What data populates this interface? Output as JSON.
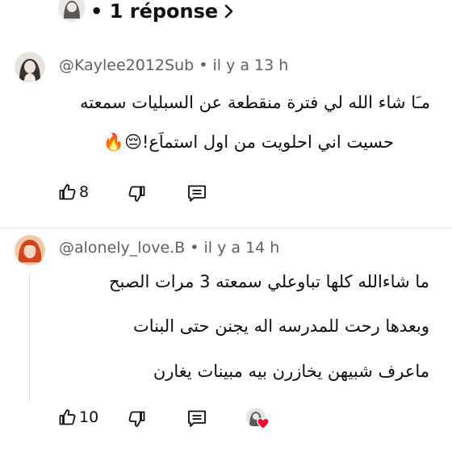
{
  "top_replies": {
    "label": "• 1 réponse"
  },
  "comments": [
    {
      "author": "@Kaylee2012Sub",
      "time": "• il y a 13 h",
      "lines": [
        "مـَا شاء الله لي فترة منقطعة عن السبليات سمعته",
        "حسيت اني احلويت من اول استماَع!😔🔥"
      ],
      "likes": "8",
      "avatar_icon": "girl-avatar-icon"
    },
    {
      "author": "@alonely_love.B",
      "time": "• il y a 14 h",
      "lines": [
        "ما شاءالله كلها تباوعلي سمعته 3 مرات الصبح",
        "وبعدها رحت للمدرسه اله يجنن حتى البنات",
        "ماعرف شبيهن يخازرن بيه مبينات يغارن"
      ],
      "likes": "10",
      "avatar_icon": "red-hair-avatar-icon"
    }
  ],
  "colors": {
    "heart": "#ff0033",
    "meta_text": "#606060",
    "thread_line": "#e5e5e5"
  }
}
